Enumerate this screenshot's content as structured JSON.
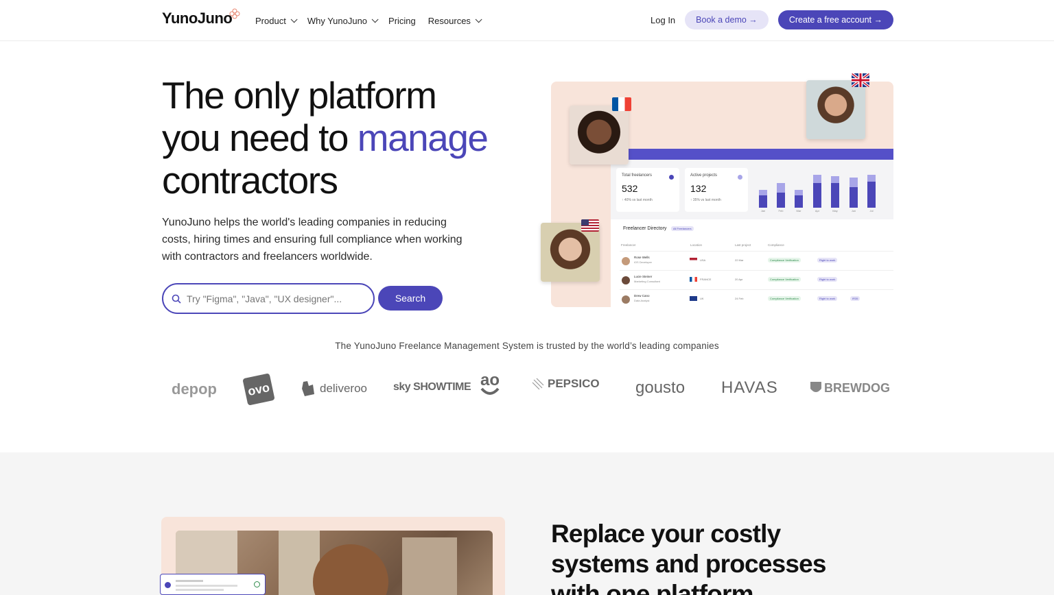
{
  "nav": {
    "brand": "YunoJuno",
    "links": [
      {
        "label": "Product",
        "has_dropdown": true
      },
      {
        "label": "Why YunoJuno",
        "has_dropdown": true
      },
      {
        "label": "Pricing",
        "has_dropdown": false
      },
      {
        "label": "Resources",
        "has_dropdown": true
      }
    ],
    "login": "Log In",
    "book_demo": "Book a demo →",
    "create_account": "Create a free account →"
  },
  "hero": {
    "title_line1": "The only platform",
    "title_line2": "you need to ",
    "title_accent": "manage",
    "title_line3": "contractors",
    "subtitle": "YunoJuno helps the world's leading companies in reducing costs, hiring times and ensuring full compliance when working with contractors and freelancers worldwide.",
    "search_placeholder": "Try \"Figma\", \"Java\", \"UX designer\"...",
    "search_button": "Search"
  },
  "dashboard": {
    "stat1": {
      "label": "Total freelancers",
      "value": "532",
      "sub": "↑ 40%  vs last month"
    },
    "stat2": {
      "label": "Active projects",
      "value": "132",
      "sub": "↑ 35%  vs last month"
    },
    "chart_months": [
      "Jan",
      "Feb",
      "Mar",
      "Apr",
      "May",
      "Jun",
      "Jul"
    ],
    "directory_title": "Freelancer Directory",
    "directory_badge": "All Freelancers",
    "headers": {
      "freelancer": "Freelancer",
      "location": "Location",
      "last_project": "Last project",
      "compliance": "Compliance"
    },
    "rows": [
      {
        "name": "Rose Wells",
        "role": "iOS Developer",
        "location": "USA",
        "date": "22 Mar",
        "tags": [
          "Compliance Verification",
          "Right to work"
        ]
      },
      {
        "name": "Lucie Steiner",
        "role": "Marketing Consultant",
        "location": "FRANCE",
        "date": "20 Apr",
        "tags": [
          "Compliance Verification",
          "Right to work"
        ]
      },
      {
        "name": "Drew Cano",
        "role": "Data Analyst",
        "location": "UK",
        "date": "24 Feb",
        "tags": [
          "Compliance Verification",
          "Right to work",
          "IR35"
        ]
      }
    ]
  },
  "trusted": {
    "text": "The YunoJuno Freelance Management System is trusted by the world’s leading companies",
    "logos": [
      "depop",
      "ovo",
      "deliveroo",
      "sky SHOWTIME",
      "ao",
      "PEPSICO",
      "gousto",
      "HAVAS",
      "BREWDOG"
    ]
  },
  "section2": {
    "title": "Replace your costly systems and processes with one platform"
  },
  "colors": {
    "accent": "#4b46b8",
    "peach": "#f8e4da"
  }
}
